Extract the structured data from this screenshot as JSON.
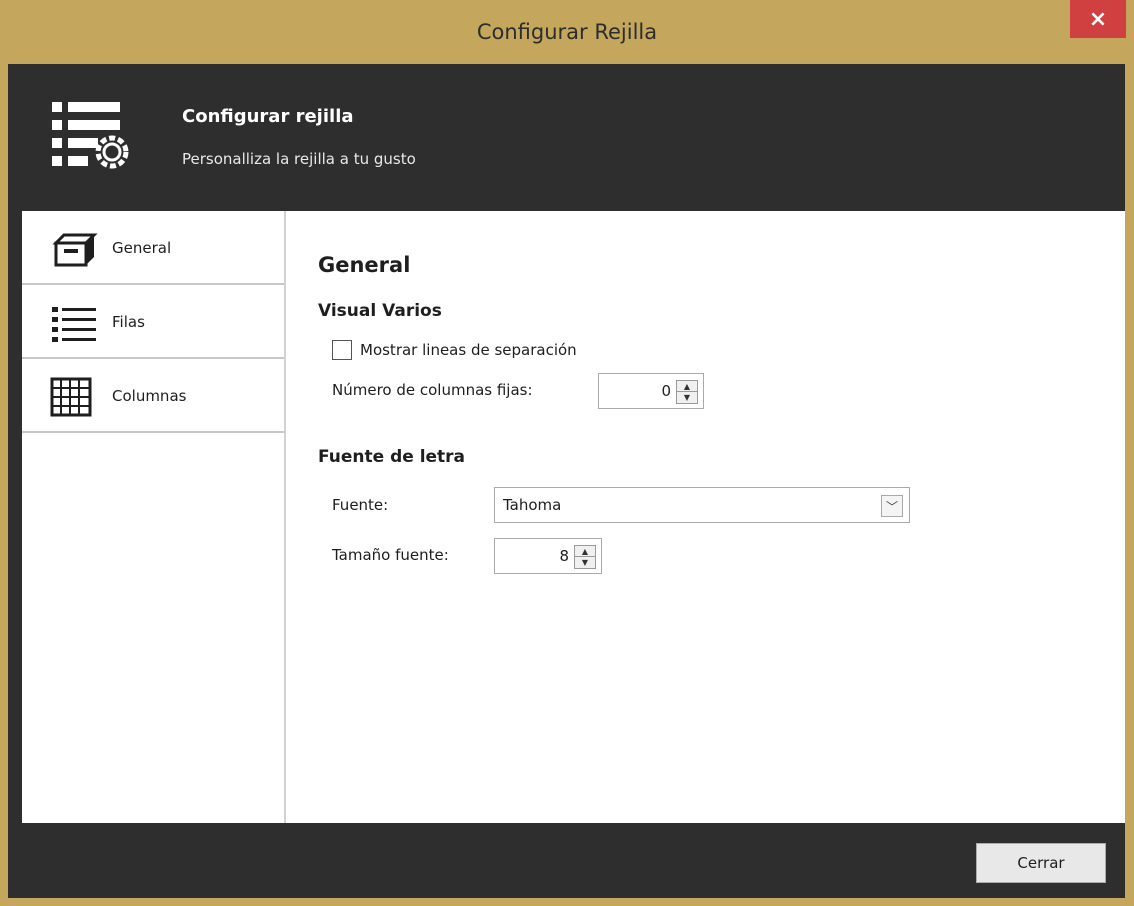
{
  "window": {
    "title": "Configurar Rejilla",
    "close_label": "×"
  },
  "header": {
    "title": "Configurar rejilla",
    "subtitle": "Personalliza la rejilla a tu gusto",
    "icon": "grid-settings-icon"
  },
  "sidebar": {
    "items": [
      {
        "label": "General",
        "icon": "box-icon"
      },
      {
        "label": "Filas",
        "icon": "list-icon"
      },
      {
        "label": "Columnas",
        "icon": "grid-icon"
      }
    ]
  },
  "panel": {
    "title": "General",
    "visual_section": {
      "heading": "Visual Varios",
      "checkbox_label": "Mostrar lineas de separación",
      "checkbox_checked": false,
      "fixed_columns_label": "Número de columnas fijas:",
      "fixed_columns_value": "0"
    },
    "font_section": {
      "heading": "Fuente de letra",
      "font_label": "Fuente:",
      "font_value": "Tahoma",
      "size_label": "Tamaño fuente:",
      "size_value": "8"
    }
  },
  "footer": {
    "close_button": "Cerrar"
  },
  "colors": {
    "frame": "#c4a65c",
    "dark": "#2e2e2e",
    "close": "#d04040"
  }
}
